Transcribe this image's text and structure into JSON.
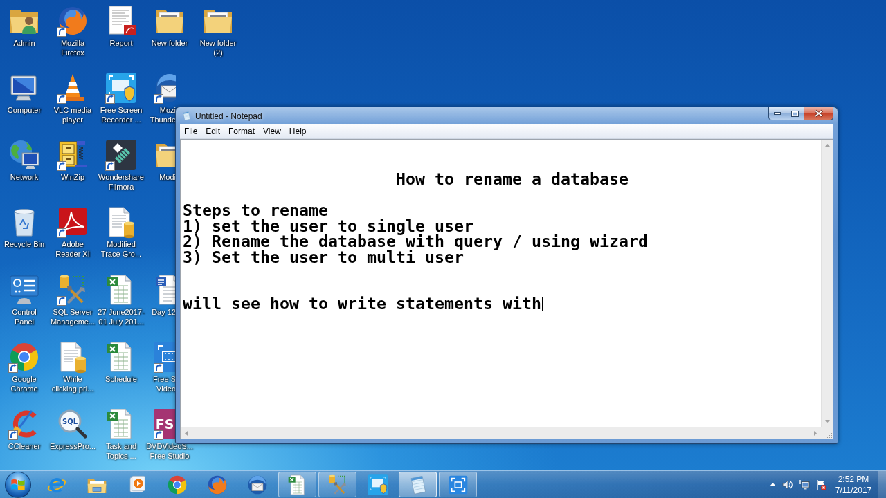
{
  "desktop": {
    "columns": [
      {
        "icons": [
          {
            "kind": "userfolder",
            "label": [
              "Admin"
            ],
            "shortcut": false
          },
          {
            "kind": "monitor",
            "label": [
              "Computer"
            ],
            "shortcut": false
          },
          {
            "kind": "globe",
            "label": [
              "Network"
            ],
            "shortcut": false
          },
          {
            "kind": "bin",
            "label": [
              "Recycle Bin"
            ],
            "shortcut": false
          },
          {
            "kind": "panel",
            "label": [
              "Control",
              "Panel"
            ],
            "shortcut": false
          },
          {
            "kind": "chrome",
            "label": [
              "Google",
              "Chrome"
            ],
            "shortcut": true
          },
          {
            "kind": "broom",
            "label": [
              "CCleaner"
            ],
            "shortcut": true
          }
        ]
      },
      {
        "icons": [
          {
            "kind": "fox",
            "label": [
              "Mozilla",
              "Firefox"
            ],
            "shortcut": true
          },
          {
            "kind": "cone",
            "label": [
              "VLC media",
              "player"
            ],
            "shortcut": true
          },
          {
            "kind": "zip",
            "label": [
              "WinZip"
            ],
            "shortcut": true
          },
          {
            "kind": "reader",
            "label": [
              "Adobe",
              "Reader XI"
            ],
            "shortcut": true
          },
          {
            "kind": "tools",
            "label": [
              "SQL Server",
              "Manageme..."
            ],
            "shortcut": true
          },
          {
            "kind": "dbdoc",
            "label": [
              "While",
              "clicking pri..."
            ],
            "shortcut": false
          },
          {
            "kind": "sql",
            "label": [
              "ExpressPro..."
            ],
            "glyph": "SQL",
            "shortcut": false
          }
        ]
      },
      {
        "icons": [
          {
            "kind": "pdf",
            "label": [
              "Report"
            ],
            "shortcut": false
          },
          {
            "kind": "recorder",
            "label": [
              "Free Screen",
              "Recorder ..."
            ],
            "shortcut": true
          },
          {
            "kind": "diamond",
            "label": [
              "Wondershare",
              "Filmora"
            ],
            "shortcut": true
          },
          {
            "kind": "dbdoc",
            "label": [
              "Modified",
              "Trace Gro..."
            ],
            "shortcut": false
          },
          {
            "kind": "sheet",
            "label": [
              "27 June2017-",
              "01 July 201..."
            ],
            "shortcut": false
          },
          {
            "kind": "sheet",
            "label": [
              "Schedule"
            ],
            "shortcut": false
          },
          {
            "kind": "sheet",
            "label": [
              "Task and",
              "Topics ..."
            ],
            "shortcut": false
          }
        ]
      },
      {
        "icons": [
          {
            "kind": "folder",
            "label": [
              "New folder"
            ],
            "shortcut": false
          },
          {
            "kind": "mail",
            "label": [
              "Mozi",
              "Thunde"
            ],
            "shortcut": true
          },
          {
            "kind": "folder",
            "label": [
              "Modi"
            ],
            "shortcut": false
          },
          {
            "kind": "worddoc",
            "label": [
              "Day 12"
            ],
            "shortcut": false
          },
          {
            "kind": "tile",
            "label": [
              "Free S",
              "Video"
            ],
            "shortcut": true
          },
          {
            "kind": "lettertile",
            "label": [
              "DVDVideoS...",
              "Free Studio"
            ],
            "glyph": "FS",
            "shortcut": true
          }
        ]
      },
      {
        "icons": [
          {
            "kind": "folder",
            "label": [
              "New folder",
              "(2)"
            ],
            "shortcut": false
          }
        ]
      }
    ]
  },
  "notepad": {
    "title": "Untitled - Notepad",
    "menu": [
      "File",
      "Edit",
      "Format",
      "View",
      "Help"
    ],
    "blocks": [
      {
        "kind": "heading",
        "lines": [
          "How to rename a database"
        ]
      },
      {
        "kind": "list",
        "lines": [
          "Steps to rename",
          "1) set the user to single user",
          "2) Rename the database with query / using wizard",
          "3) Set the user to multi user"
        ]
      },
      {
        "kind": "paragraph",
        "lines": [
          "will see how to write statements with"
        ]
      }
    ],
    "caret": true
  },
  "taskbar": {
    "buttons": [
      {
        "kind": "ie",
        "running": false,
        "selected": false
      },
      {
        "kind": "explorer",
        "running": false,
        "selected": false
      },
      {
        "kind": "media",
        "running": false,
        "selected": false
      },
      {
        "kind": "chrome",
        "running": false,
        "selected": false
      },
      {
        "kind": "fox",
        "running": false,
        "selected": false
      },
      {
        "kind": "mail",
        "running": false,
        "selected": false
      },
      {
        "kind": "sheet",
        "running": true,
        "selected": false
      },
      {
        "kind": "tools",
        "running": true,
        "selected": false
      },
      {
        "kind": "recorder",
        "running": false,
        "selected": false
      },
      {
        "kind": "notepad",
        "running": true,
        "selected": true
      },
      {
        "kind": "capture",
        "running": true,
        "selected": false
      }
    ],
    "clock": {
      "time": "2:52 PM",
      "date": "7/11/2017"
    }
  }
}
